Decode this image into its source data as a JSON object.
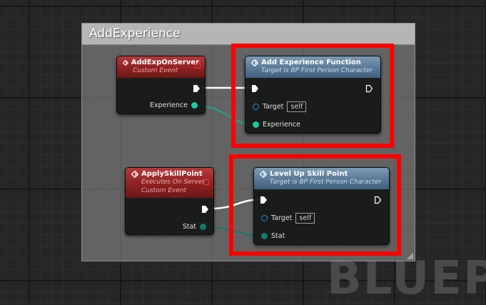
{
  "watermark": "BLUEP",
  "comment": {
    "title": "AddExperience"
  },
  "nodes": {
    "add_exp_on_server": {
      "title": "AddExpOnServer",
      "subtitle": "Custom Event",
      "pin_experience": "Experience"
    },
    "add_experience_function": {
      "title": "Add Experience Function",
      "subtitle": "Target is BP First Person Character",
      "pin_target": "Target",
      "target_value": "self",
      "pin_experience": "Experience"
    },
    "apply_skill_point": {
      "title": "ApplySkillPoint",
      "subtitle_1": "Executes On Server",
      "subtitle_2": "Custom Event",
      "pin_stat": "Stat"
    },
    "level_up_skill_point": {
      "title": "Level Up Skill Point",
      "subtitle": "Target is BP First Person Character",
      "pin_target": "Target",
      "target_value": "self",
      "pin_stat": "Stat"
    }
  },
  "colors": {
    "exec_wire": "#ffffff",
    "data_wire": "#1dc8a0",
    "highlight": "#ff0000",
    "event_header": "#8a1f1f",
    "function_header": "#557694"
  }
}
